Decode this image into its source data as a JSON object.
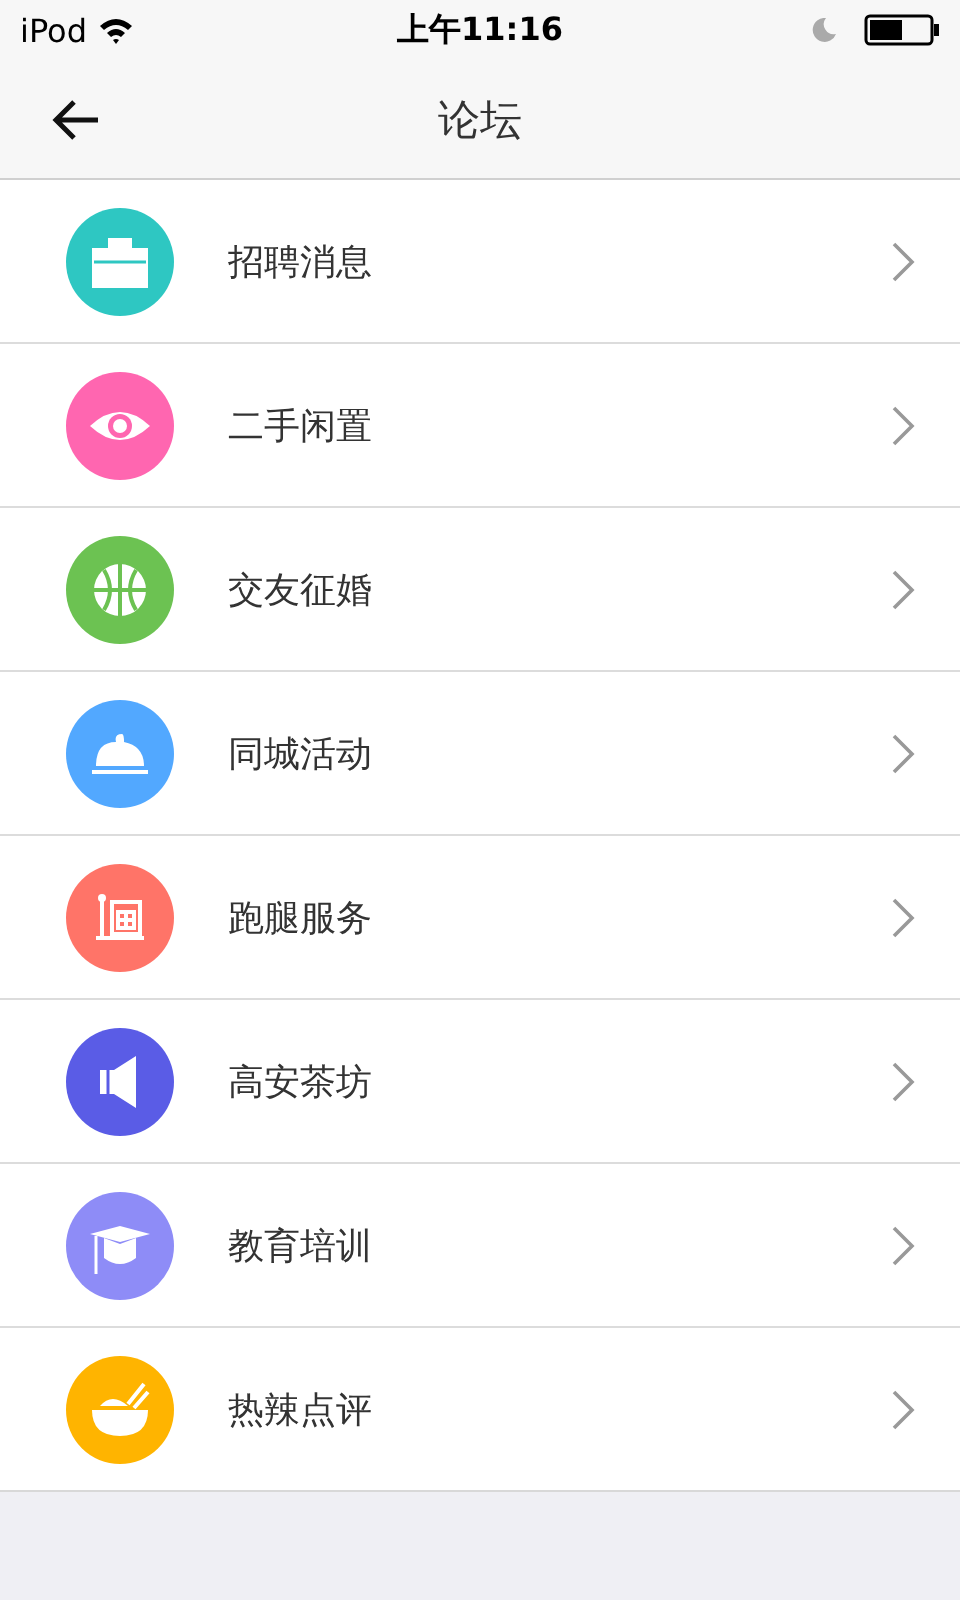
{
  "status_bar": {
    "carrier": "iPod",
    "time": "上午11:16"
  },
  "nav": {
    "title": "论坛"
  },
  "items": [
    {
      "label": "招聘消息",
      "kind": "bag",
      "color": "#2ec7c2"
    },
    {
      "label": "二手闲置",
      "kind": "eye",
      "color": "#ff66b0"
    },
    {
      "label": "交友征婚",
      "kind": "ball",
      "color": "#6cc252"
    },
    {
      "label": "同城活动",
      "kind": "cloche",
      "color": "#52a8ff"
    },
    {
      "label": "跑腿服务",
      "kind": "building",
      "color": "#ff7468"
    },
    {
      "label": "高安茶坊",
      "kind": "speaker",
      "color": "#5a5ce6"
    },
    {
      "label": "教育培训",
      "kind": "cap",
      "color": "#8e8cf7"
    },
    {
      "label": "热辣点评",
      "kind": "bowl",
      "color": "#ffb400"
    }
  ]
}
